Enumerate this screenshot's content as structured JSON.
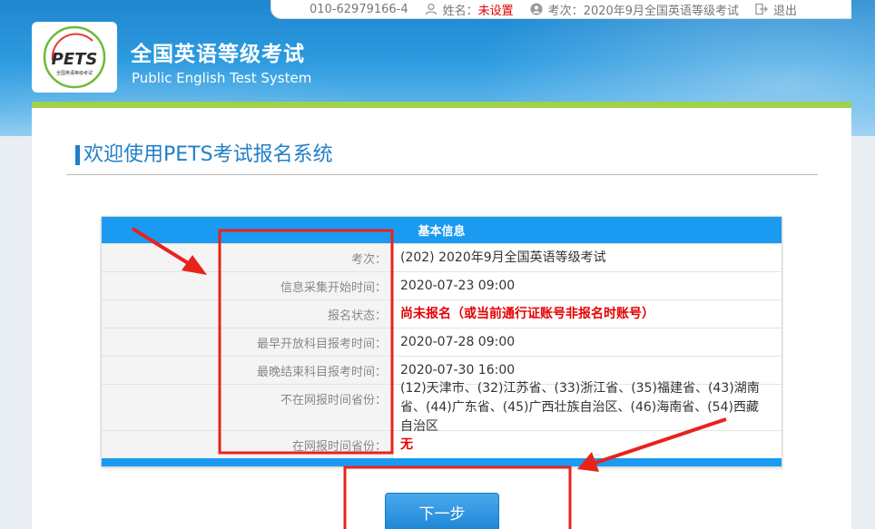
{
  "topbar": {
    "phone": "010-62979166-4",
    "name_label": "姓名：",
    "name_value": "未设置",
    "exam_label": "考次：",
    "exam_value": "2020年9月全国英语等级考试",
    "logout": "退出"
  },
  "brand": {
    "logo_text": "PETS",
    "logo_subtext": "全国英语等级考试",
    "title_cn": "全国英语等级考试",
    "title_en": "Public English Test System"
  },
  "page": {
    "title": "欢迎使用PETS考试报名系统"
  },
  "info": {
    "header": "基本信息",
    "rows": [
      {
        "label": "考次：",
        "value": "(202) 2020年9月全国英语等级考试"
      },
      {
        "label": "信息采集开始时间：",
        "value": "2020-07-23 09:00"
      },
      {
        "label": "报名状态：",
        "value": "尚未报名（或当前通行证账号非报名时账号）"
      },
      {
        "label": "最早开放科目报考时间：",
        "value": "2020-07-28 09:00"
      },
      {
        "label": "最晚结束科目报考时间：",
        "value": "2020-07-30 16:00"
      },
      {
        "label": "不在网报时间省份：",
        "value": "(12)天津市、(32)江苏省、(33)浙江省、(35)福建省、(43)湖南省、(44)广东省、(45)广西壮族自治区、(46)海南省、(54)西藏自治区"
      },
      {
        "label": "在网报时间省份：",
        "value": "无"
      }
    ]
  },
  "actions": {
    "next_label": "下一步"
  },
  "colors": {
    "primary": "#1a9af0",
    "accent_green": "#9fd24a",
    "status_red": "#e60000",
    "annotation_red": "#e8231b"
  }
}
